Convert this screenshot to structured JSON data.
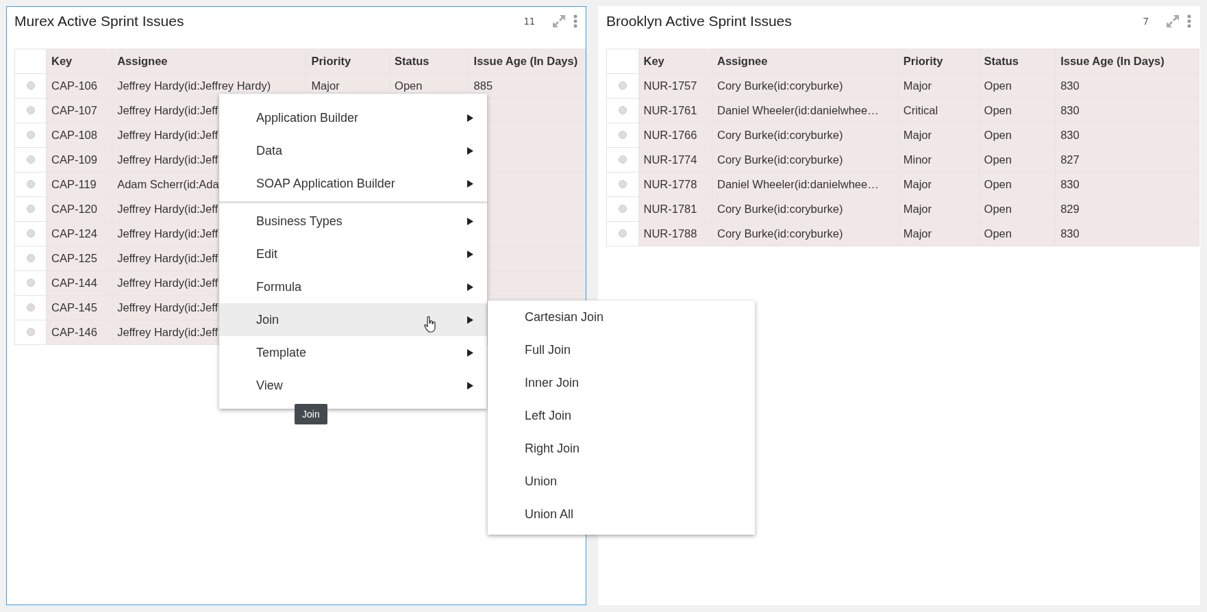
{
  "panels": [
    {
      "title": "Murex Active Sprint Issues",
      "count": "11",
      "focused": true,
      "columns": [
        "Key",
        "Assignee",
        "Priority",
        "Status",
        "Issue Age (In Days)"
      ],
      "rows": [
        {
          "selected": false,
          "cells": [
            "CAP-106",
            "Jeffrey Hardy(id:Jeffrey Hardy)",
            "Major",
            "Open",
            "885"
          ]
        },
        {
          "selected": false,
          "cells": [
            "CAP-107",
            "Jeffrey Hardy(id:Jeff"
          ]
        },
        {
          "selected": false,
          "cells": [
            "CAP-108",
            "Jeffrey Hardy(id:Jeff"
          ]
        },
        {
          "selected": false,
          "cells": [
            "CAP-109",
            "Jeffrey Hardy(id:Jeff"
          ]
        },
        {
          "selected": false,
          "cells": [
            "CAP-119",
            "Adam Scherr(id:Ada"
          ]
        },
        {
          "selected": false,
          "cells": [
            "CAP-120",
            "Jeffrey Hardy(id:Jeff"
          ]
        },
        {
          "selected": false,
          "cells": [
            "CAP-124",
            "Jeffrey Hardy(id:Jeff"
          ]
        },
        {
          "selected": false,
          "cells": [
            "CAP-125",
            "Jeffrey Hardy(id:Jeff"
          ]
        },
        {
          "selected": false,
          "cells": [
            "CAP-144",
            "Jeffrey Hardy(id:Jeff"
          ]
        },
        {
          "selected": false,
          "cells": [
            "CAP-145",
            "Jeffrey Hardy(id:Jeff"
          ]
        },
        {
          "selected": false,
          "cells": [
            "CAP-146",
            "Jeffrey Hardy(id:Jeff"
          ]
        }
      ]
    },
    {
      "title": "Brooklyn Active Sprint Issues",
      "count": "7",
      "focused": false,
      "columns": [
        "Key",
        "Assignee",
        "Priority",
        "Status",
        "Issue Age (In Days)"
      ],
      "rows": [
        {
          "selected": false,
          "cells": [
            "NUR-1757",
            "Cory Burke(id:coryburke)",
            "Major",
            "Open",
            "830"
          ]
        },
        {
          "selected": false,
          "cells": [
            "NUR-1761",
            "Daniel Wheeler(id:danielwhee…",
            "Critical",
            "Open",
            "830"
          ]
        },
        {
          "selected": false,
          "cells": [
            "NUR-1766",
            "Cory Burke(id:coryburke)",
            "Major",
            "Open",
            "830"
          ]
        },
        {
          "selected": false,
          "cells": [
            "NUR-1774",
            "Cory Burke(id:coryburke)",
            "Minor",
            "Open",
            "827"
          ]
        },
        {
          "selected": false,
          "cells": [
            "NUR-1778",
            "Daniel Wheeler(id:danielwhee…",
            "Major",
            "Open",
            "830"
          ]
        },
        {
          "selected": false,
          "cells": [
            "NUR-1781",
            "Cory Burke(id:coryburke)",
            "Major",
            "Open",
            "829"
          ]
        },
        {
          "selected": false,
          "cells": [
            "NUR-1788",
            "Cory Burke(id:coryburke)",
            "Major",
            "Open",
            "830"
          ]
        }
      ]
    }
  ],
  "context_menu": {
    "groups": [
      [
        {
          "label": "Application Builder",
          "selected": false
        },
        {
          "label": "Data",
          "selected": false
        },
        {
          "label": "SOAP Application Builder",
          "selected": false
        }
      ],
      [
        {
          "label": "Business Types",
          "selected": false
        },
        {
          "label": "Edit",
          "selected": false
        },
        {
          "label": "Formula",
          "selected": false
        },
        {
          "label": "Join",
          "selected": true
        },
        {
          "label": "Template",
          "selected": false
        },
        {
          "label": "View",
          "selected": false
        }
      ]
    ]
  },
  "submenu": {
    "items": [
      {
        "label": "Cartesian Join"
      },
      {
        "label": "Full Join"
      },
      {
        "label": "Inner Join"
      },
      {
        "label": "Left Join"
      },
      {
        "label": "Right Join"
      },
      {
        "label": "Union"
      },
      {
        "label": "Union All"
      }
    ]
  },
  "tooltip": {
    "text": "Join"
  }
}
